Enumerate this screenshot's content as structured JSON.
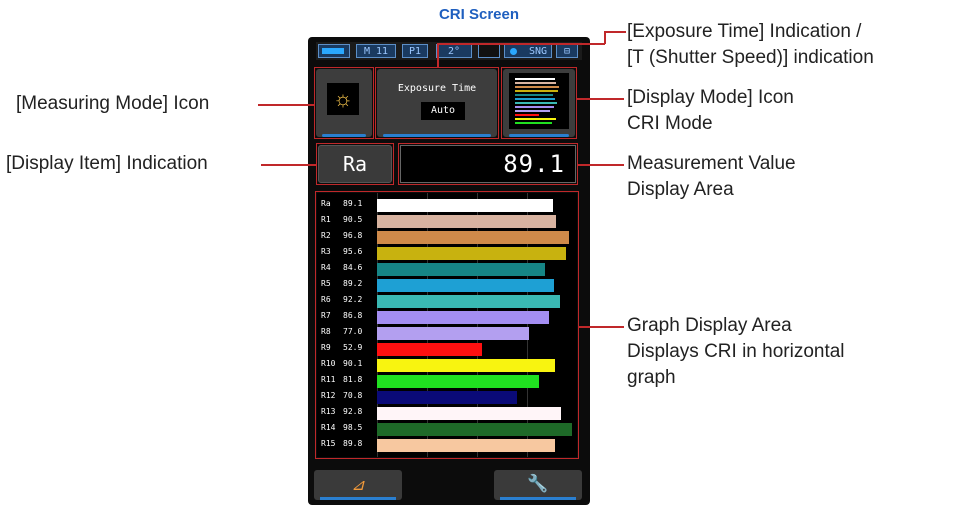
{
  "screen_title": "CRI Screen",
  "annotations": {
    "exposure_line1": "[Exposure Time] Indication /",
    "exposure_line2": "[T (Shutter Speed)] indication",
    "measuring_mode": "[Measuring Mode] Icon",
    "display_mode_line1": "[Display Mode] Icon",
    "display_mode_line2": "CRI Mode",
    "display_item": "[Display Item] Indication",
    "measurement_line1": "Measurement Value",
    "measurement_line2": "Display Area",
    "graph_line1": "Graph Display Area",
    "graph_line2": "Displays CRI in horizontal",
    "graph_line3": "graph"
  },
  "status_bar": {
    "memory": "M 11",
    "preset": "P1",
    "angle": "2°",
    "mode": "SNG"
  },
  "exposure": {
    "label": "Exposure Time",
    "value": "Auto"
  },
  "display_item": "Ra",
  "measurement_value": "89.1",
  "cri_rows": [
    {
      "label": "Ra",
      "value": "89.1",
      "num": 89.1,
      "color": "#ffffff"
    },
    {
      "label": "R1",
      "value": "90.5",
      "num": 90.5,
      "color": "#d8b3a0"
    },
    {
      "label": "R2",
      "value": "96.8",
      "num": 96.8,
      "color": "#cf8a4a"
    },
    {
      "label": "R3",
      "value": "95.6",
      "num": 95.6,
      "color": "#c8b20f"
    },
    {
      "label": "R4",
      "value": "84.6",
      "num": 84.6,
      "color": "#168586"
    },
    {
      "label": "R5",
      "value": "89.2",
      "num": 89.2,
      "color": "#1ea0d4"
    },
    {
      "label": "R6",
      "value": "92.2",
      "num": 92.2,
      "color": "#3ab9b4"
    },
    {
      "label": "R7",
      "value": "86.8",
      "num": 86.8,
      "color": "#a48ef2"
    },
    {
      "label": "R8",
      "value": "77.0",
      "num": 77.0,
      "color": "#b39ff0"
    },
    {
      "label": "R9",
      "value": "52.9",
      "num": 52.9,
      "color": "#ff1010"
    },
    {
      "label": "R10",
      "value": "90.1",
      "num": 90.1,
      "color": "#f8f410"
    },
    {
      "label": "R11",
      "value": "81.8",
      "num": 81.8,
      "color": "#20e020"
    },
    {
      "label": "R12",
      "value": "70.8",
      "num": 70.8,
      "color": "#0a0a78"
    },
    {
      "label": "R13",
      "value": "92.8",
      "num": 92.8,
      "color": "#fff5f8"
    },
    {
      "label": "R14",
      "value": "98.5",
      "num": 98.5,
      "color": "#1e6a28"
    },
    {
      "label": "R15",
      "value": "89.8",
      "num": 89.8,
      "color": "#f7c8a0"
    }
  ],
  "icons": {
    "measuring_mode": "sun-icon",
    "display_mode": "cri-bars-icon",
    "bottom_left": "delta-icon",
    "bottom_right": "wrench-icon"
  },
  "colors": {
    "title": "#1f5fbf",
    "callout_line": "#c0282a",
    "button_accent": "#2a7fd0"
  }
}
